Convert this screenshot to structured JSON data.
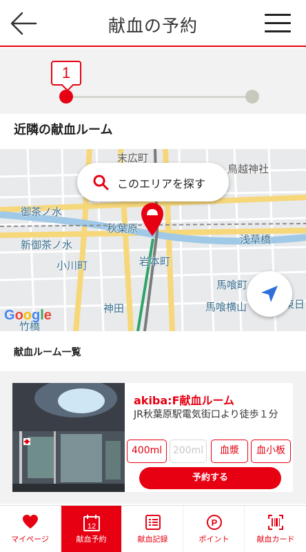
{
  "header": {
    "title": "献血の予約"
  },
  "progress": {
    "current_step": "1"
  },
  "section": {
    "nearby_title": "近隣の献血ルーム"
  },
  "map": {
    "search_button_label": "このエリアを探す",
    "google_logo": "Google",
    "labels": {
      "suehirocho": "末広町",
      "torigoe": "鳥越神社",
      "ochanomizu": "御茶ノ水",
      "akihabara": "秋葉原",
      "shin_ochanomizu": "新御茶ノ水",
      "ogawamachi": "小川町",
      "asakusabashi": "浅草橋",
      "iwamotocho": "岩本町",
      "bakurocho": "馬喰町",
      "kanda": "神田",
      "bakuro_yokoyama": "馬喰横山",
      "takebashi": "竹橋",
      "higashi": "東日"
    }
  },
  "list": {
    "title": "献血ルーム一覧",
    "rooms": [
      {
        "name": "akiba:F献血ルーム",
        "access": "JR秋葉原駅電気街口より徒歩１分",
        "chips": [
          "400ml",
          "200ml",
          "血漿",
          "血小板"
        ],
        "reserve_label": "予約する"
      }
    ]
  },
  "nav": [
    {
      "label": "マイページ",
      "icon": "heart-icon"
    },
    {
      "label": "献血予約",
      "icon": "calendar-icon",
      "calendar_day": "12"
    },
    {
      "label": "献血記録",
      "icon": "list-icon"
    },
    {
      "label": "ポイント",
      "icon": "point-icon",
      "badge": "P"
    },
    {
      "label": "献血カード",
      "icon": "barcode-icon"
    }
  ],
  "colors": {
    "accent": "#e60012",
    "background": "#f2f2f2",
    "inactive_dot": "#c8c8bd"
  }
}
